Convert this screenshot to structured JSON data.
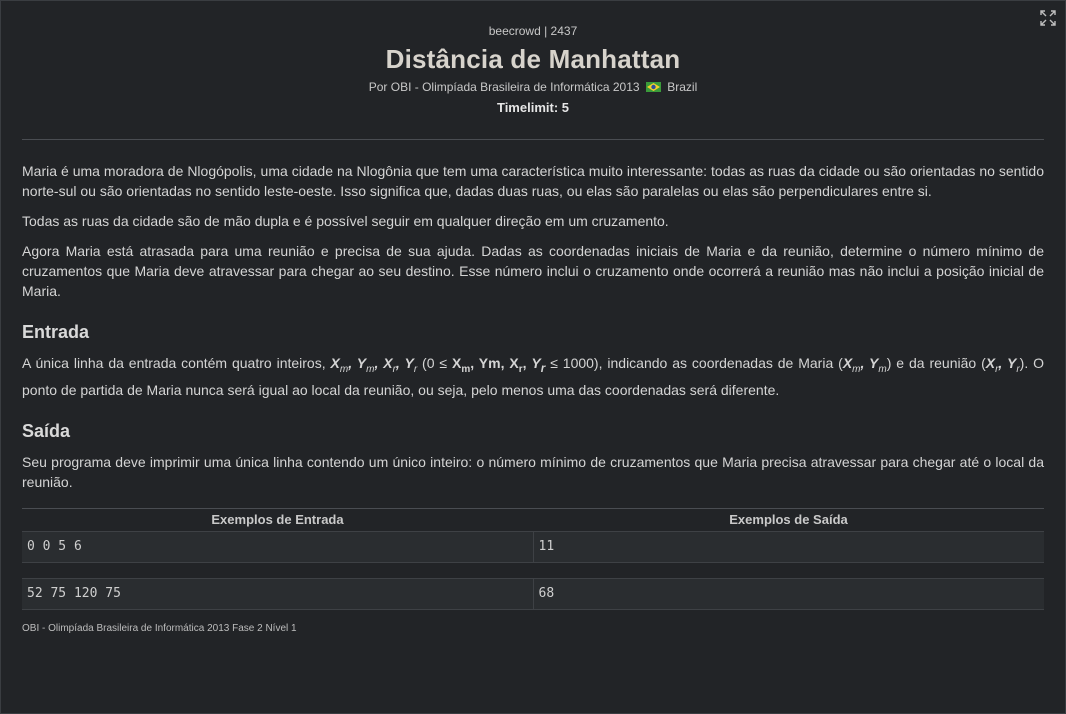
{
  "header": {
    "source": "beecrowd | 2437",
    "title": "Distância de Manhattan",
    "author_prefix": "Por OBI - Olimpíada Brasileira de Informática 2013",
    "country": "Brazil",
    "timelimit": "Timelimit: 5"
  },
  "description": {
    "p1": "Maria é uma moradora de Nlogópolis, uma cidade na Nlogônia que tem uma característica muito interessante: todas as ruas da cidade ou são orientadas no sentido norte-sul ou são orientadas no sentido leste-oeste. Isso significa que, dadas duas ruas, ou elas são paralelas ou elas são perpendiculares entre si.",
    "p2": "Todas as ruas da cidade são de mão dupla e é possível seguir em qualquer direção em um cruzamento.",
    "p3": "Agora Maria está atrasada para uma reunião e precisa de sua ajuda. Dadas as coordenadas iniciais de Maria e da reunião, determine o número mínimo de cruzamentos que Maria deve atravessar para chegar ao seu destino. Esse número inclui o cruzamento onde ocorrerá a reunião mas não inclui a posição inicial de Maria."
  },
  "input_section": {
    "heading": "Entrada",
    "text_a": "A única linha da entrada contém quatro inteiros, ",
    "text_b": " (0 ≤ ",
    "text_c": " ≤ 1000), indicando as coordenadas de Maria (",
    "text_d": ") e da reunião (",
    "text_e": "). O ponto de partida de Maria nunca será igual ao local da reunião, ou seja, pelo menos uma das coordenadas será diferente."
  },
  "output_section": {
    "heading": "Saída",
    "text": "Seu programa deve imprimir uma única linha contendo um único inteiro: o número mínimo de cruzamentos que Maria precisa atravessar para chegar até o local da reunião."
  },
  "examples": {
    "input_header": "Exemplos de Entrada",
    "output_header": "Exemplos de Saída",
    "rows": [
      {
        "input": "0 0 5 6",
        "output": "11"
      },
      {
        "input": "52 75 120 75",
        "output": "68"
      }
    ]
  },
  "footer": "OBI - Olimpíada Brasileira de Informática 2013 Fase 2 Nível 1",
  "icons": {
    "expand": "expand-icon",
    "flag": "brazil-flag-icon"
  },
  "colors": {
    "background": "#222427",
    "text": "#d4d4d4",
    "title": "#d7d3cc"
  }
}
